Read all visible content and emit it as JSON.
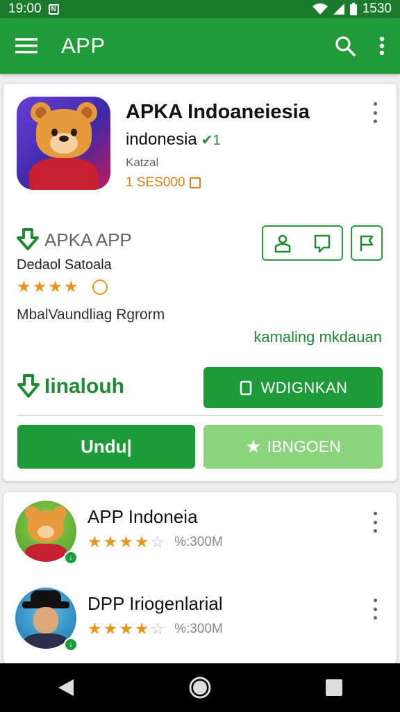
{
  "status_bar": {
    "time": "19:00",
    "battery_time": "1530"
  },
  "app_bar": {
    "title": "APP"
  },
  "featured": {
    "title": "APKA Indoaneiesia",
    "subtitle": "indonesia",
    "version": "✔1",
    "developer": "Katzal",
    "size": "1 SES000",
    "brand_label": "APKA APP",
    "dev_name": "Dedaol Satoala",
    "rating_stars": 4,
    "category": "MbalVaundliag Rgrorm",
    "install_status": "kamaling mkdauan",
    "install_label": "Iinalouh",
    "secondary_button": "WDIGNKAN",
    "download_button": "Undu|",
    "promo_button": "IBNGOEN"
  },
  "list": [
    {
      "title": "APP Indoneia",
      "rating_stars": 4,
      "meta": "%:300M"
    },
    {
      "title": "DPP Iriogenlarial",
      "rating_stars": 4,
      "meta": "%:300M"
    }
  ],
  "colors": {
    "primary": "#219a3a",
    "status_bar": "#1b7a2c",
    "star": "#e6961c",
    "accent_light": "#8bd47d"
  },
  "icons": [
    "menu-icon",
    "search-icon",
    "more-vert-icon",
    "download-icon",
    "person-icon",
    "chat-icon",
    "flag-icon",
    "star-icon",
    "back-icon",
    "home-icon",
    "recents-icon"
  ]
}
